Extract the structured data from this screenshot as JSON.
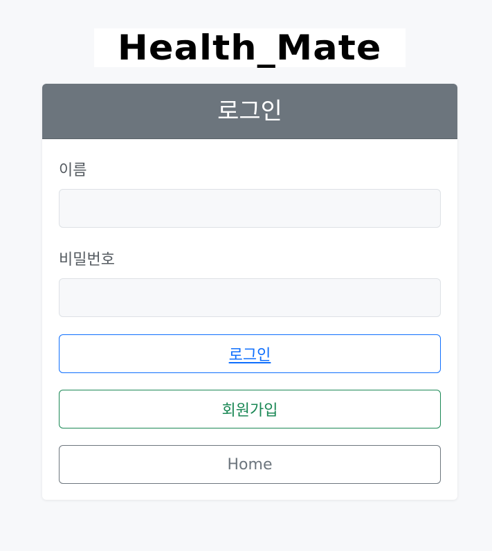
{
  "logo": {
    "text": "Health_Mate"
  },
  "card": {
    "title": "로그인",
    "fields": {
      "name": {
        "label": "이름",
        "value": "",
        "placeholder": ""
      },
      "password": {
        "label": "비밀번호",
        "value": "",
        "placeholder": ""
      }
    },
    "buttons": {
      "login": "로그인",
      "signup": "회원가입",
      "home": "Home"
    }
  },
  "colors": {
    "page_background": "#f7f8fa",
    "header_background": "#6c757d",
    "login_accent": "#0d6efd",
    "signup_accent": "#198754",
    "home_accent": "#6c757d"
  }
}
